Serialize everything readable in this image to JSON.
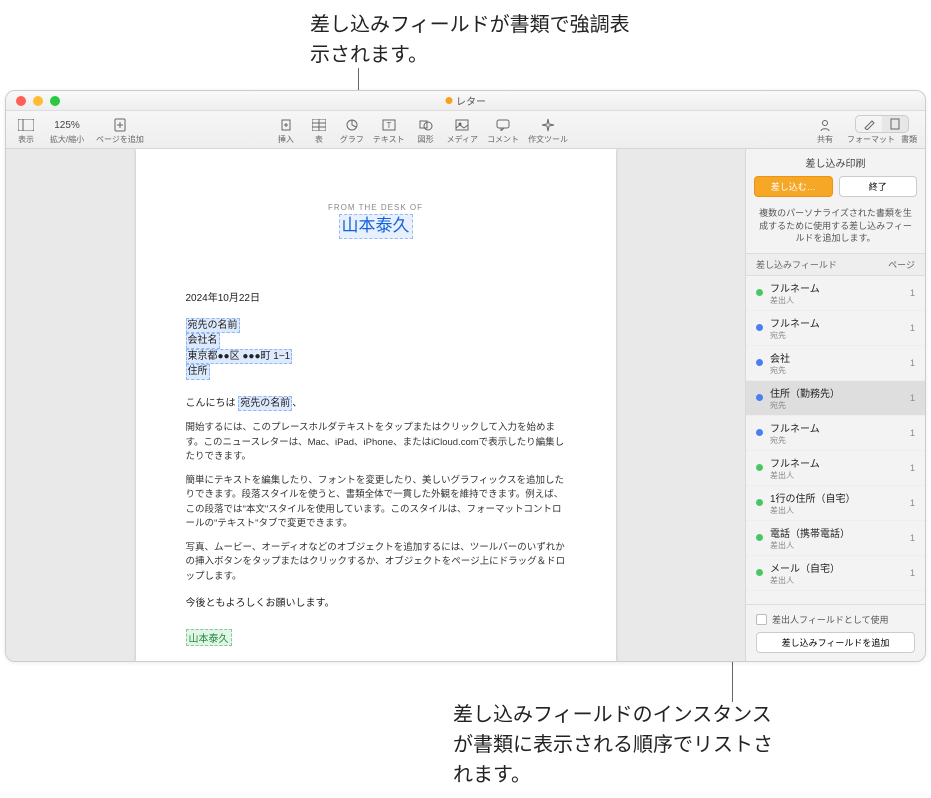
{
  "annotations": {
    "top": "差し込みフィールドが書類で強調表示されます。",
    "bottom": "差し込みフィールドのインスタンスが書類に表示される順序でリストされます。"
  },
  "window": {
    "title": "レター"
  },
  "toolbar": {
    "view": "表示",
    "zoom_value": "125%",
    "zoom": "拡大/縮小",
    "add_page": "ページを追加",
    "insert": "挿入",
    "table": "表",
    "chart": "グラフ",
    "text": "テキスト",
    "shape": "図形",
    "media": "メディア",
    "comment": "コメント",
    "author": "作文ツール",
    "share": "共有",
    "format": "フォーマット",
    "document": "書類"
  },
  "document": {
    "from_desk": "FROM THE DESK OF",
    "sender_name": "山本泰久",
    "date": "2024年10月22日",
    "fields": {
      "recipient_name": "宛先の名前",
      "company": "会社名",
      "address_line": "東京都●●区 ●●●町 1−1",
      "address_label": "住所"
    },
    "greeting_prefix": "こんにちは ",
    "greeting_field": "宛先の名前",
    "greeting_suffix": "、",
    "para1": "開始するには、このプレースホルダテキストをタップまたはクリックして入力を始めます。このニュースレターは、Mac、iPad、iPhone、またはiCloud.comで表示したり編集したりできます。",
    "para2": "簡単にテキストを編集したり、フォントを変更したり、美しいグラフィックスを追加したりできます。段落スタイルを使うと、書類全体で一貫した外観を維持できます。例えば、この段落では\"本文\"スタイルを使用しています。このスタイルは、フォーマットコントロールの\"テキスト\"タブで変更できます。",
    "para3": "写真、ムービー、オーディオなどのオブジェクトを追加するには、ツールバーのいずれかの挿入ボタンをタップまたはクリックするか、オブジェクトをページ上にドラッグ＆ドロップします。",
    "closing": "今後ともよろしくお願いします。",
    "signature": "山本泰久"
  },
  "inspector": {
    "title": "差し込み印刷",
    "btn_merge": "差し込む…",
    "btn_done": "終了",
    "description": "複数のパーソナライズされた書類を生成するために使用する差し込みフィールドを追加します。",
    "col_field": "差し込みフィールド",
    "col_page": "ページ",
    "fields": [
      {
        "name": "フルネーム",
        "sub": "差出人",
        "count": "1",
        "color": "green",
        "selected": false
      },
      {
        "name": "フルネーム",
        "sub": "宛先",
        "count": "1",
        "color": "blue",
        "selected": false
      },
      {
        "name": "会社",
        "sub": "宛先",
        "count": "1",
        "color": "blue",
        "selected": false
      },
      {
        "name": "住所（勤務先）",
        "sub": "宛先",
        "count": "1",
        "color": "blue",
        "selected": true
      },
      {
        "name": "フルネーム",
        "sub": "宛先",
        "count": "1",
        "color": "blue",
        "selected": false
      },
      {
        "name": "フルネーム",
        "sub": "差出人",
        "count": "1",
        "color": "green",
        "selected": false
      },
      {
        "name": "1行の住所（自宅）",
        "sub": "差出人",
        "count": "1",
        "color": "green",
        "selected": false
      },
      {
        "name": "電話（携帯電話）",
        "sub": "差出人",
        "count": "1",
        "color": "green",
        "selected": false
      },
      {
        "name": "メール（自宅）",
        "sub": "差出人",
        "count": "1",
        "color": "green",
        "selected": false
      }
    ],
    "use_as_sender": "差出人フィールドとして使用",
    "add_field": "差し込みフィールドを追加"
  }
}
